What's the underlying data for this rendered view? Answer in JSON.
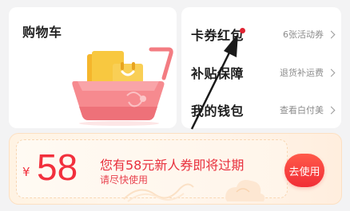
{
  "cart": {
    "title": "购物车"
  },
  "menu": {
    "items": [
      {
        "label": "卡券红包",
        "desc": "6张活动券",
        "has_dot": true
      },
      {
        "label": "补贴保障",
        "desc": "退货补运费"
      },
      {
        "label": "我的钱包",
        "desc": "查看白付美"
      }
    ]
  },
  "coupon": {
    "currency": "¥",
    "amount": "58",
    "message": "您有58元新人券即将过期",
    "sub_message": "请尽快使用",
    "button_label": "去使用"
  },
  "colors": {
    "accent_red": "#f2303d",
    "dot_red": "#e02433",
    "banner_bg": "#fff3e3",
    "cart_pink": "#f3838a",
    "cart_box": "#f7c23f"
  }
}
